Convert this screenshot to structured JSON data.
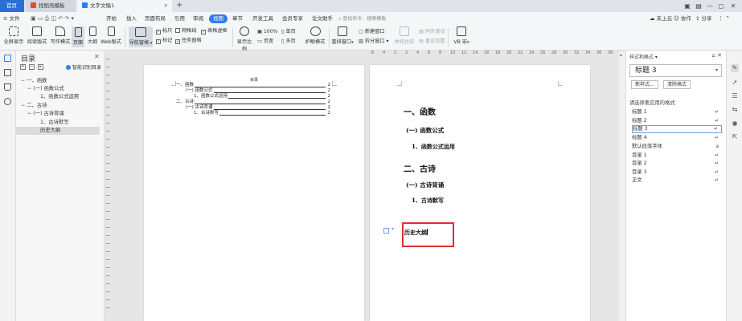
{
  "titlebar": {
    "tab_home": "首页",
    "tab_template": "找稻壳模板",
    "tab_doc": "文字文稿1",
    "add_tab": "+",
    "controls": [
      "▣",
      "▤",
      "—",
      "◻",
      "✕"
    ]
  },
  "menubar": {
    "file": "≡ 文件",
    "items": [
      "开始",
      "插入",
      "页面布局",
      "引用",
      "审阅",
      "视图",
      "章节",
      "开发工具",
      "会员专享",
      "论文助手"
    ],
    "active": "视图",
    "search": "查找命令、搜索模板",
    "right": [
      "未上云",
      "协作",
      "分享"
    ]
  },
  "toolbar": {
    "buttons": [
      "全屏显示",
      "阅读版式",
      "写作模式",
      "页面",
      "大纲",
      "Web版式"
    ],
    "nav_pane": "导航窗格",
    "checks": [
      {
        "label": "标尺",
        "checked": true
      },
      {
        "label": "网格线",
        "checked": false
      },
      {
        "label": "表格虚框",
        "checked": true
      },
      {
        "label": "标记",
        "checked": true
      },
      {
        "label": "任务窗格",
        "checked": true
      }
    ],
    "zoom_btn": "显示比例",
    "zoom_100": "100%",
    "single_page": "单页",
    "multi_page": "多页",
    "page_width": "页宽",
    "eye_mode": "护眼模式",
    "rearrange": "重排窗口",
    "new_window": "新建窗口",
    "split_window": "拆分窗口",
    "side_by_side": "并排比较",
    "sync_scroll": "同步滚动",
    "reset_position": "重设位置",
    "macro": "VB 宏"
  },
  "nav": {
    "title": "目录",
    "smart_btn": "智能识别目录",
    "items": [
      {
        "text": "一、函数",
        "level": 1,
        "sel": false
      },
      {
        "text": "(一) 函数公式",
        "level": 2,
        "sel": false
      },
      {
        "text": "1、函数公式运用",
        "level": 3,
        "sel": false
      },
      {
        "text": "二、古诗",
        "level": 1,
        "sel": false
      },
      {
        "text": "(一) 古诗背诵",
        "level": 2,
        "sel": false
      },
      {
        "text": "1、古诗默写",
        "level": 3,
        "sel": false
      },
      {
        "text": "历史大纲",
        "level": 3,
        "sel": true
      }
    ]
  },
  "ruler": {
    "h_labels": [
      "6",
      "4",
      "2",
      "2",
      "4",
      "6",
      "8",
      "10",
      "12",
      "14",
      "16",
      "18",
      "20",
      "22",
      "24",
      "26",
      "28",
      "30",
      "32",
      "34",
      "36",
      "38",
      "40"
    ]
  },
  "toc": {
    "title": "目录",
    "lines": [
      {
        "text": "一、函数",
        "page": "2"
      },
      {
        "text": "(一) 函数公式",
        "page": "2"
      },
      {
        "text": "1、函数公式运用",
        "page": "2"
      },
      {
        "text": "二、古诗",
        "page": "2"
      },
      {
        "text": "(一) 古诗背诵",
        "page": "2"
      },
      {
        "text": "1、古诗默写",
        "page": "2"
      }
    ]
  },
  "doc": {
    "h1_a": "一、函数",
    "h2_a": "(一) 函数公式",
    "h3_a": "1、函数公式运用",
    "h1_b": "二、古诗",
    "h2_b": "(一) 古诗背诵",
    "h3_b": "1、古诗默写",
    "current": "历史大纲"
  },
  "styles_panel": {
    "header": "样式和格式 ▾",
    "current_style": "标题 3",
    "new_style": "新样式...",
    "clear_format": "清除格式",
    "label": "请选择要应用的格式",
    "items": [
      {
        "name": "标题 1",
        "mark": "↵",
        "sel": false
      },
      {
        "name": "标题 2",
        "mark": "↵",
        "sel": false
      },
      {
        "name": "标题 3",
        "mark": "↵",
        "sel": true
      },
      {
        "name": "标题 4",
        "mark": "↵",
        "sel": false
      },
      {
        "name": "默认段落字体",
        "mark": "a",
        "sel": false
      },
      {
        "name": "目录 1",
        "mark": "↵",
        "sel": false
      },
      {
        "name": "目录 2",
        "mark": "↵",
        "sel": false
      },
      {
        "name": "目录 3",
        "mark": "↵",
        "sel": false
      },
      {
        "name": "正文",
        "mark": "↵",
        "sel": false
      }
    ]
  },
  "colors": {
    "accent": "#2f7cf6",
    "highlight_border": "#d9322c"
  }
}
